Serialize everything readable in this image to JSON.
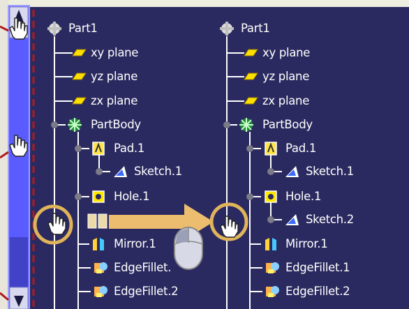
{
  "colors": {
    "background": "#2b2a60",
    "scroll_track": "#5a5cff",
    "scroll_border": "#9fa0ff",
    "page_light": "#eeeee0",
    "tree_line": "#ffffff",
    "plane_icon": "#ffe000",
    "hole_icon": "#ffe800",
    "drag_arrow": "#ecbd6e",
    "highlight_circle": "#e0b45a",
    "separator_dash": "#b01a1a"
  },
  "tree_before": {
    "root": "Part1",
    "planes": [
      "xy plane",
      "yz plane",
      "zx plane"
    ],
    "part_body": "PartBody",
    "pad": "Pad.1",
    "pad_sketch": "Sketch.1",
    "hole": "Hole.1",
    "mirror": "Mirror.1",
    "edge_fillet_1": "EdgeFillet.1",
    "edge_fillet_2": "EdgeFillet.2"
  },
  "tree_after": {
    "root": "Part1",
    "planes": [
      "xy plane",
      "yz plane",
      "zx plane"
    ],
    "part_body": "PartBody",
    "pad": "Pad.1",
    "pad_sketch": "Sketch.1",
    "hole": "Hole.1",
    "hole_sketch": "Sketch.2",
    "mirror": "Mirror.1",
    "edge_fillet_1": "EdgeFillet.1",
    "edge_fillet_2": "EdgeFillet.2"
  },
  "icons": {
    "part": "part-gear-icon",
    "plane": "plane-icon",
    "body": "body-icon",
    "pad": "pad-icon",
    "sketch": "sketch-icon",
    "hole": "hole-icon",
    "mirror": "mirror-icon",
    "fillet": "edge-fillet-icon",
    "hand": "hand-cursor-icon",
    "mouse": "mouse-icon"
  }
}
